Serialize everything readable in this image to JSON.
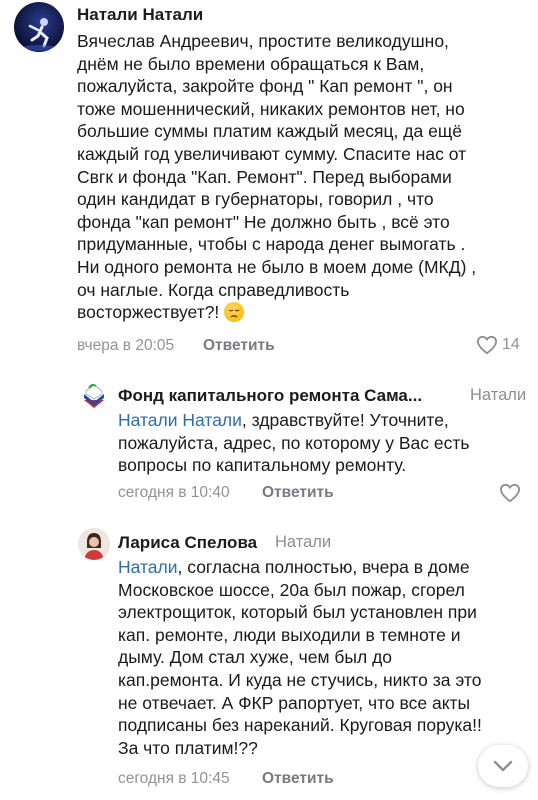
{
  "comments": [
    {
      "author": "Натали Натали",
      "lines": [
        "Вячеслав Андреевич, простите великодушно,",
        "днём не было времени обращаться к Вам,",
        "пожалуйста, закройте фонд \" Кап ремонт \", он",
        "тоже мошеннический, никаких ремонтов нет, но",
        "большие суммы платим каждый месяц, да ещё",
        "каждый  год увеличивают сумму. Спасите нас от",
        "Свгк и  фонда \"Кап. Ремонт\". Перед выборами",
        "один кандидат  в губернаторы, говорил , что",
        "фонда \"кап ремонт\" Не должно быть , всё это",
        "придуманные, чтобы с народа денег вымогать .",
        "Ни одного ремонта не было в моем доме (МКД) ,",
        "оч наглые. Когда справедливость",
        "восторжествует?! "
      ],
      "emoji": "disappointed-face",
      "time": "вчера в 20:05",
      "reply_label": "Ответить",
      "likes": "14"
    },
    {
      "author": "Фонд капитального ремонта Сама...",
      "reply_to": "Натали",
      "mention": "Натали Натали",
      "lines": [
        ", здравствуйте! Уточните,",
        "пожалуйста, адрес, по которому у Вас есть",
        "вопросы по капитальному ремонту."
      ],
      "time": "сегодня в 10:40",
      "reply_label": "Ответить"
    },
    {
      "author": "Лариса Спелова",
      "reply_to": "Натали",
      "mention": "Натали",
      "lines": [
        ", согласна полностью, вчера в доме",
        "Московское шоссе, 20а был пожар, сгорел",
        "электрощиток, который был установлен при",
        "кап. ремонте, люди выходили в темноте и",
        "дыму. Дом стал хуже, чем был до",
        "кап.ремонта. И куда не стучись, никто за это",
        "не отвечает. А ФКР рапортует, что все акты",
        "подписаны без нареканий. Круговая порука!!",
        "За что платим!??"
      ],
      "time": "сегодня в 10:45",
      "reply_label": "Ответить"
    }
  ],
  "colors": {
    "mention": "#2f6ea5",
    "meta": "#929297",
    "text": "#1a1a1a"
  },
  "icons": [
    "heart-outline-icon",
    "heart-outline-icon",
    "chevron-down-icon"
  ]
}
